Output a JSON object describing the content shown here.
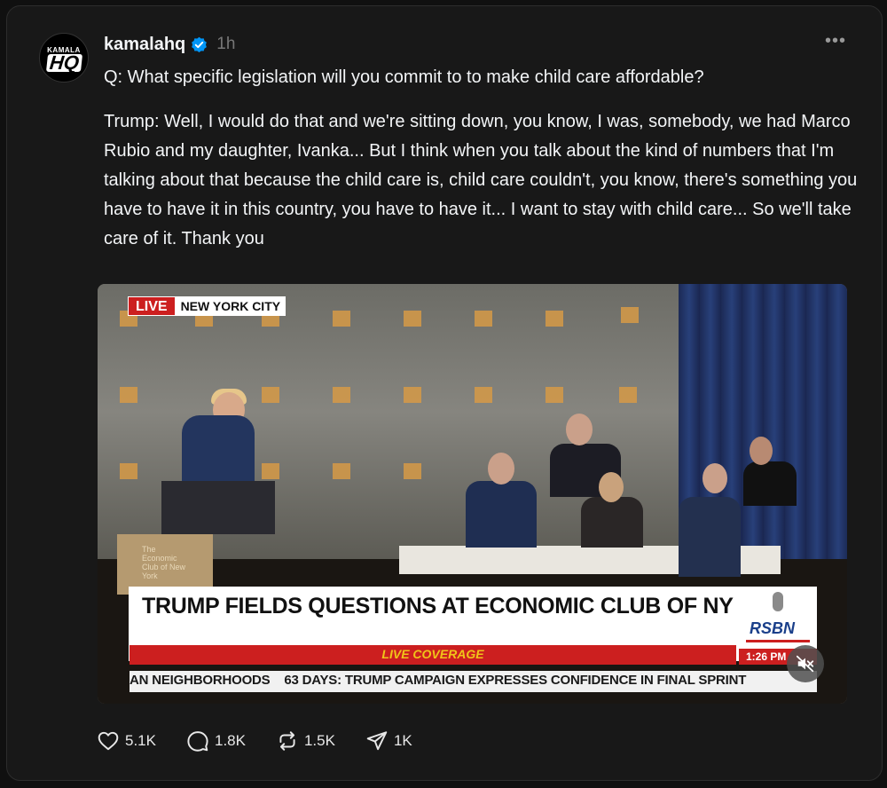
{
  "post": {
    "username": "kamalahq",
    "time": "1h",
    "more": "•••",
    "avatar_top": "KAMALA",
    "avatar_main": "HQ",
    "question": "Q: What specific legislation will you commit to to make child care affordable?",
    "answer": "Trump: Well, I would do that and we're sitting down, you know, I was, somebody, we had Marco Rubio and my daughter, Ivanka... But I think when you talk about the kind of numbers that I'm talking about that because the child care is, child care couldn't, you know, there's something you have to have it in this country, you have to have it... I want to stay with child care... So we'll take care of it. Thank you"
  },
  "video": {
    "live_label": "LIVE",
    "location": "NEW YORK CITY",
    "headline": "TRUMP FIELDS QUESTIONS AT ECONOMIC CLUB OF NY",
    "live_coverage": "LIVE COVERAGE",
    "network": "RSBN",
    "clock": "1:26 PM",
    "ticker": "AN NEIGHBORHOODS    63 DAYS: TRUMP CAMPAIGN EXPRESSES CONFIDENCE IN FINAL SPRINT",
    "podium_text": "The Economic Club of New York"
  },
  "actions": {
    "likes": "5.1K",
    "comments": "1.8K",
    "reposts": "1.5K",
    "shares": "1K"
  },
  "colors": {
    "background": "#101010",
    "card": "#181818",
    "verified": "#0095f6",
    "live_red": "#cc1f1f"
  }
}
